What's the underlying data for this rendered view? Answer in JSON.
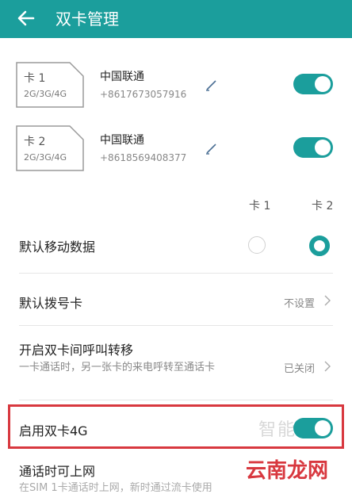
{
  "header": {
    "title": "双卡管理"
  },
  "sims": [
    {
      "name": "卡 1",
      "type": "2G/3G/4G",
      "carrier": "中国联通",
      "number": "+8617673057916",
      "enabled": true
    },
    {
      "name": "卡 2",
      "type": "2G/3G/4G",
      "carrier": "中国联通",
      "number": "+8618569408377",
      "enabled": true
    }
  ],
  "columns": {
    "sim1": "卡 1",
    "sim2": "卡 2"
  },
  "settings": {
    "default_data": {
      "label": "默认移动数据",
      "selected": "卡 2"
    },
    "default_dial": {
      "label": "默认拨号卡",
      "value": "不设置"
    },
    "call_forward": {
      "label": "开启双卡间呼叫转移",
      "description": "一卡通话时，另一张卡的来电呼转至通话卡",
      "value": "已关闭"
    },
    "dual_4g": {
      "label": "启用双卡4G",
      "enabled": true
    },
    "internet_during_call": {
      "label": "通话时可上网",
      "description": "在SIM 1卡通话时上网，新时通过流卡使用"
    }
  },
  "watermark": {
    "top": "智能家",
    "bottom": "云南龙网"
  },
  "colors": {
    "accent": "#1b9e9c",
    "highlight": "#d8383f"
  }
}
